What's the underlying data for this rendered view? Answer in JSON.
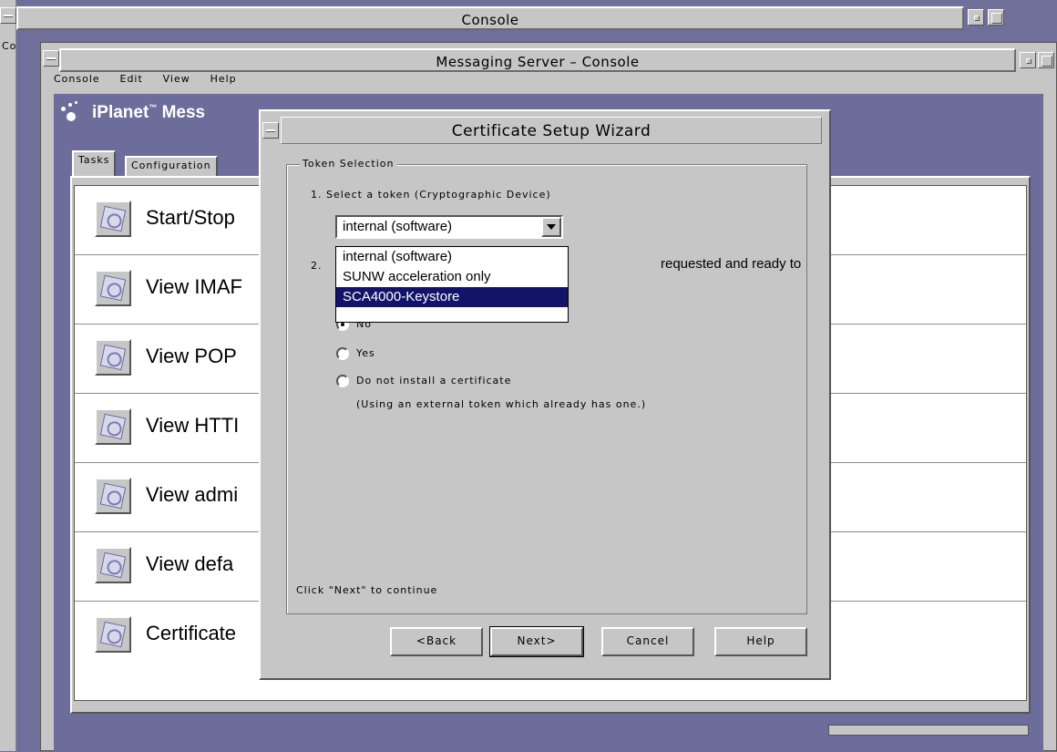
{
  "outer_window": {
    "title": "Console",
    "menu_fragment": "Co"
  },
  "inner_window": {
    "title": "Messaging Server – Console",
    "menu": [
      "Console",
      "Edit",
      "View",
      "Help"
    ]
  },
  "logo": {
    "text": "iPlanet",
    "tm": "™",
    "product_fragment": "Mess"
  },
  "tabs": [
    "Tasks",
    "Configuration"
  ],
  "tasks": [
    {
      "label": "Start/Stop"
    },
    {
      "label": "View IMAF"
    },
    {
      "label": "View POP"
    },
    {
      "label": "View HTTI"
    },
    {
      "label": "View admi"
    },
    {
      "label": "View defa"
    },
    {
      "label": "Certificate"
    }
  ],
  "wizard": {
    "title": "Certificate Setup Wizard",
    "group_title": "Token Selection",
    "step1": "1. Select a token (Cryptographic Device)",
    "combo_value": "internal (software)",
    "dropdown_options": [
      "internal (software)",
      "SUNW acceleration only",
      "SCA4000-Keystore"
    ],
    "selected_option": "SCA4000-Keystore",
    "step2_num": "2.",
    "step2_fragment": "requested and ready to",
    "radio_options": [
      {
        "label": "No",
        "checked": true
      },
      {
        "label": "Yes",
        "checked": false
      },
      {
        "label": "Do not install a certificate",
        "checked": false
      }
    ],
    "radio_note": "(Using an external token which already has one.)",
    "footer_hint": "Click \"Next\" to continue",
    "buttons": {
      "back": "<Back",
      "next": "Next>",
      "cancel": "Cancel",
      "help": "Help"
    }
  },
  "colors": {
    "desktop": "#6f6f9a",
    "window_gray": "#c6c6c6",
    "selection": "#13136a"
  }
}
